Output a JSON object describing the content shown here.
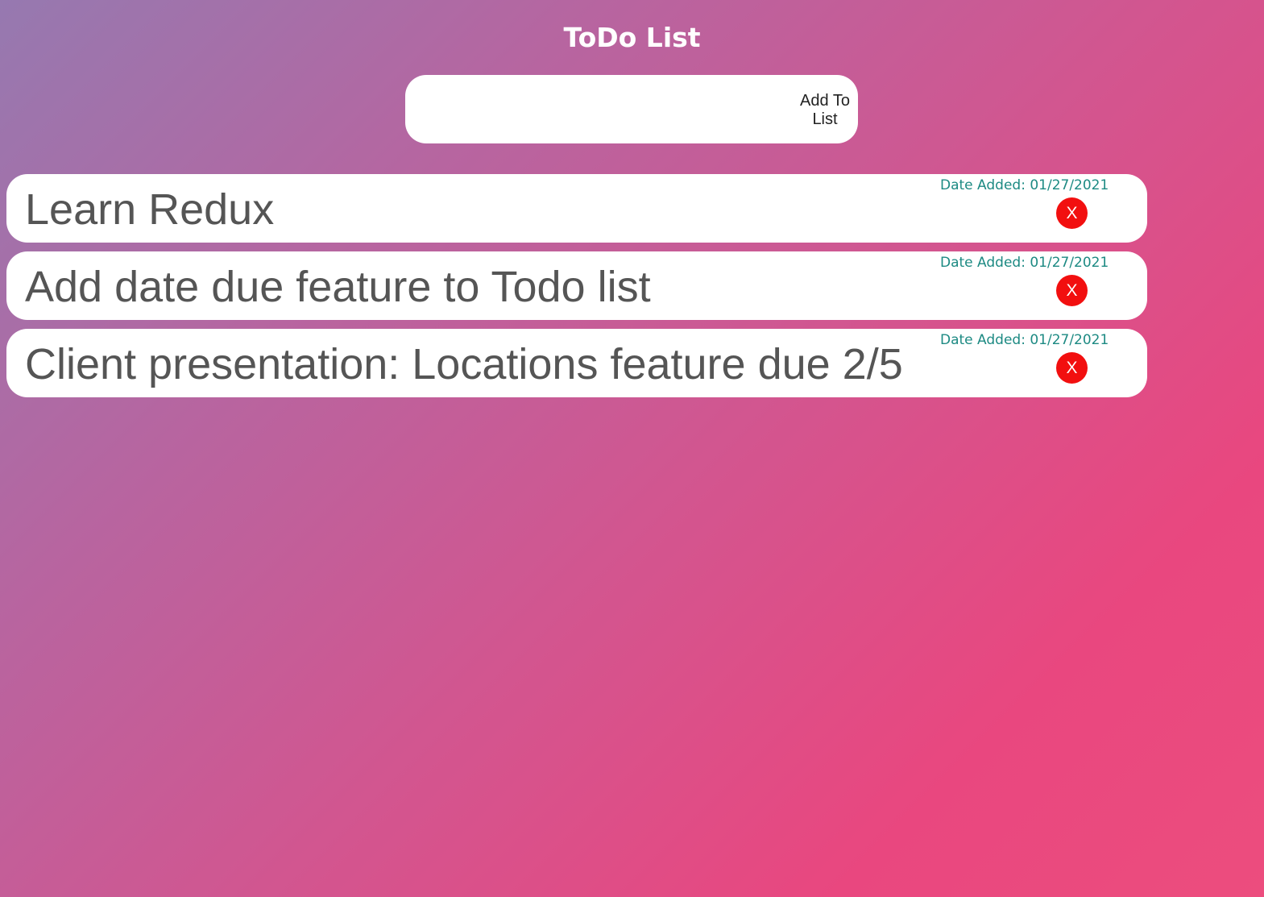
{
  "header": {
    "title": "ToDo List"
  },
  "add_form": {
    "input_value": "",
    "input_placeholder": "",
    "button_label": "Add To List"
  },
  "todos": [
    {
      "text": "Learn Redux",
      "date_added": "Date Added: 01/27/2021",
      "delete_label": "X"
    },
    {
      "text": "Add date due feature to Todo list",
      "date_added": "Date Added: 01/27/2021",
      "delete_label": "X"
    },
    {
      "text": "Client presentation: Locations feature due 2/5",
      "date_added": "Date Added: 01/27/2021",
      "delete_label": "X"
    }
  ],
  "colors": {
    "date_text": "#1d8a83",
    "delete_button": "#f20f0f",
    "gradient_start": "#9679b0",
    "gradient_end": "#ec4d7e"
  },
  "icons": {
    "delete": "close-icon"
  }
}
